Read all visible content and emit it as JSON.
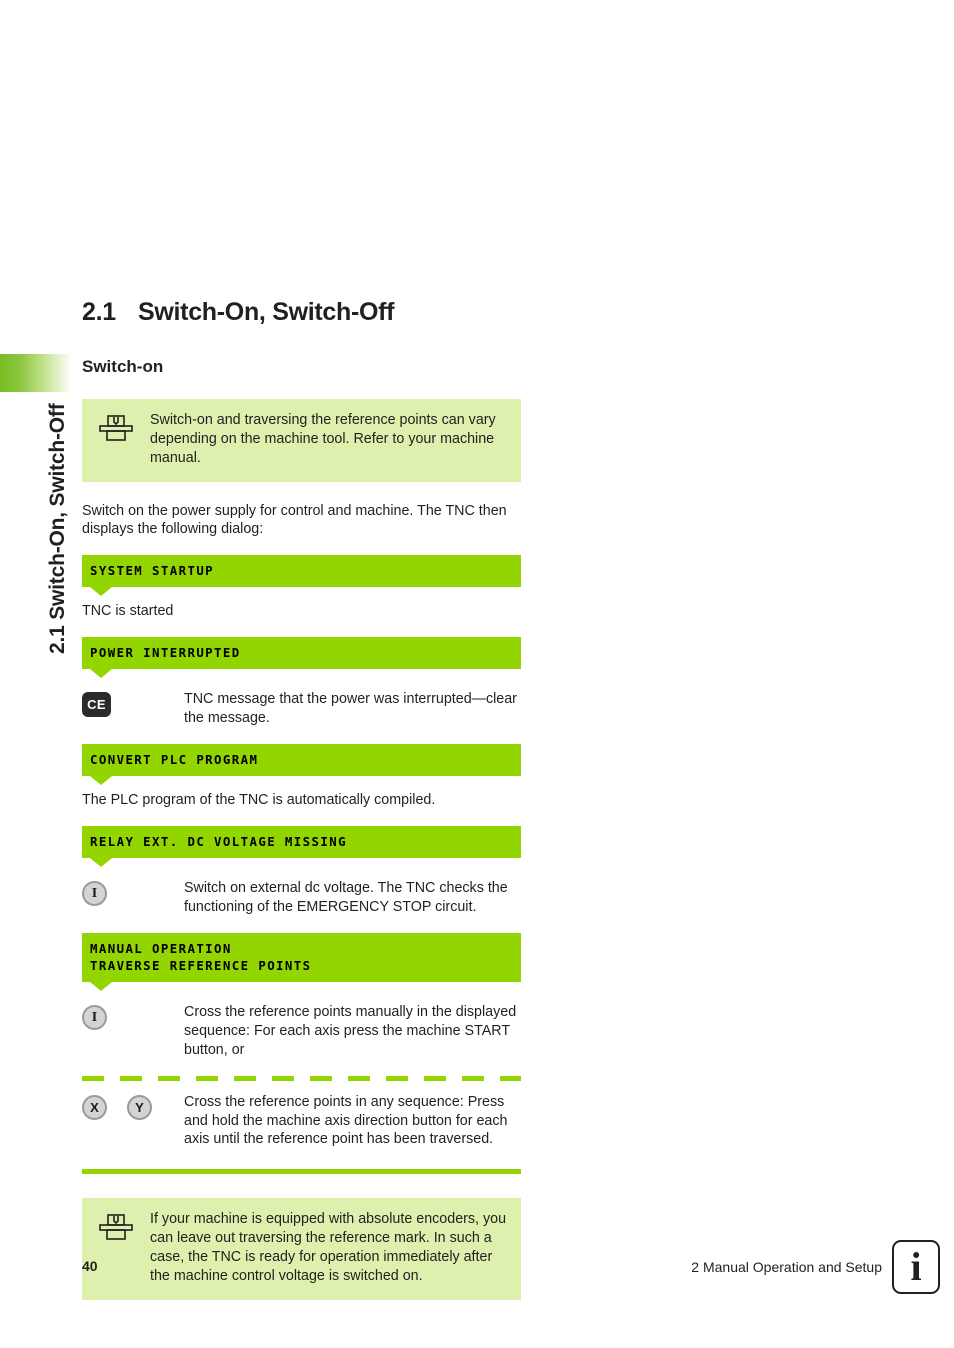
{
  "sidebar": {
    "running_head": "2.1 Switch-On, Switch-Off",
    "tab_color": "#8cc63f"
  },
  "page": {
    "section_number": "2.1",
    "section_title": "Switch-On, Switch-Off",
    "sub_heading": "Switch-on"
  },
  "colors": {
    "bar_green": "#93d500",
    "note_green": "#ddf0ae",
    "key_dark": "#2b2b2b",
    "key_gray": "#d4d4d4"
  },
  "notes": {
    "top": {
      "icon": "machine-tool-icon",
      "text": "Switch-on and traversing the reference points can vary depending on the machine tool. Refer to your machine manual."
    },
    "bottom": {
      "icon": "machine-tool-icon",
      "text": "If your machine is equipped with absolute encoders, you can leave out traversing the reference mark. In such a case, the TNC is ready for operation immediately after the machine control voltage is switched on."
    }
  },
  "paragraphs": {
    "intro": "Switch on the power supply for control and machine. The TNC then displays the following dialog:",
    "tnc_started": "TNC is started",
    "plc_compiled": "The PLC program of the TNC is automatically compiled."
  },
  "dialogs": {
    "system_startup": {
      "line1": "SYSTEM STARTUP"
    },
    "power_interrupted": {
      "line1": "POWER INTERRUPTED"
    },
    "convert_plc": {
      "line1": "CONVERT PLC PROGRAM"
    },
    "relay_voltage": {
      "line1": "RELAY EXT. DC VOLTAGE MISSING"
    },
    "manual_operation": {
      "line1": "MANUAL OPERATION",
      "line2": "TRAVERSE REFERENCE POINTS"
    }
  },
  "steps": {
    "clear_message": {
      "key": "CE",
      "key_name": "ce-key",
      "text": "TNC message that the power was interrupted—clear the message."
    },
    "external_voltage": {
      "key": "I",
      "key_name": "i-key",
      "text": "Switch on external dc voltage. The TNC checks the functioning of the EMERGENCY STOP circuit."
    },
    "manual_sequence": {
      "key": "I",
      "key_name": "i-key",
      "text": "Cross the reference points manually in the displayed sequence: For each axis press the machine START button, or"
    },
    "any_sequence": {
      "key_x": "X",
      "key_y": "Y",
      "text": "Cross the reference points in any sequence: Press and hold the machine axis direction button for each axis until the reference point has been traversed."
    }
  },
  "footer": {
    "page_number": "40",
    "chapter_title": "2 Manual Operation and Setup",
    "badge_glyph": "i"
  }
}
